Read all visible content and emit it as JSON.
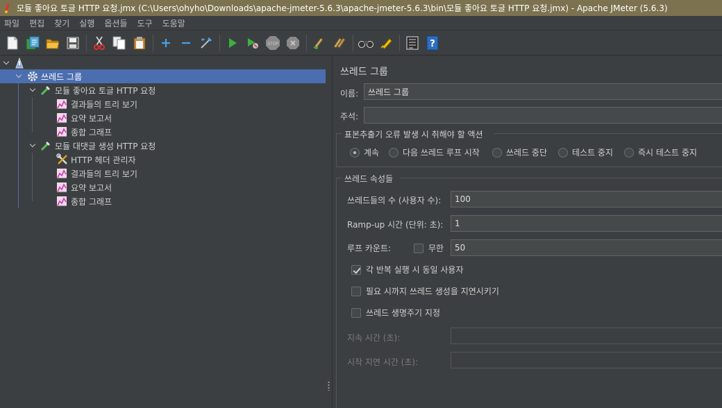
{
  "window": {
    "title": "모듈 좋아요 토글 HTTP 요청.jmx (C:\\Users\\ohyho\\Downloads\\apache-jmeter-5.6.3\\apache-jmeter-5.6.3\\bin\\모듈 좋아요 토글 HTTP 요청.jmx) - Apache JMeter (5.6.3)"
  },
  "menu": [
    "파일",
    "편집",
    "찾기",
    "실행",
    "옵션들",
    "도구",
    "도움말"
  ],
  "toolbar": {
    "icons": [
      "new-icon",
      "templates-icon",
      "open-icon",
      "save-icon",
      "cut-icon",
      "copy-icon",
      "paste-icon",
      "expand-icon",
      "collapse-icon",
      "toggle-icon",
      "start-icon",
      "start-no-pause-icon",
      "stop-icon",
      "shutdown-icon",
      "clear-icon",
      "clear-all-icon",
      "search-icon",
      "reset-search-icon",
      "function-helper-icon",
      "help-icon"
    ]
  },
  "tree": {
    "root_label": "",
    "thread_group": "쓰레드 그룹",
    "samplers": [
      {
        "label": "모듈 좋아요 토글 HTTP 요청",
        "children": [
          "결과들의 트리 보기",
          "요약 보고서",
          "종합 그래프"
        ]
      },
      {
        "label": "모듈 대댓글 생성 HTTP 요청",
        "children": [
          "HTTP 헤더 관리자",
          "결과들의 트리 보기",
          "요약 보고서",
          "종합 그래프"
        ]
      }
    ]
  },
  "panel": {
    "title": "쓰레드 그룹",
    "name_label": "이름:",
    "name_value": "쓰레드 그룹",
    "comment_label": "주석:",
    "comment_value": "",
    "error_section": "표본추출기 오류 발생 시 취해야 할 액션",
    "error_actions": [
      "계속",
      "다음 쓰레드 루프 시작",
      "쓰레드 중단",
      "테스트 중지",
      "즉시 테스트 중지"
    ],
    "error_selected": 0,
    "props_section": "쓰레드 속성들",
    "threads_label": "쓰레드들의 수 (사용자 수):",
    "threads_value": "100",
    "rampup_label": "Ramp-up 시간 (단위: 초):",
    "rampup_value": "1",
    "loop_label": "루프 카운트:",
    "infinite_label": "무한",
    "infinite_checked": false,
    "loop_value": "50",
    "same_user_label": "각 반복 실행 시 동일 사용자",
    "same_user_checked": true,
    "delay_label": "필요 시까지 쓰레드 생성을 지연시키기",
    "delay_checked": false,
    "lifetime_label": "쓰레드 생명주기 지정",
    "lifetime_checked": false,
    "duration_label": "지속 시간 (초):",
    "duration_value": "",
    "startup_delay_label": "시작 지연 시간 (초):",
    "startup_delay_value": ""
  }
}
